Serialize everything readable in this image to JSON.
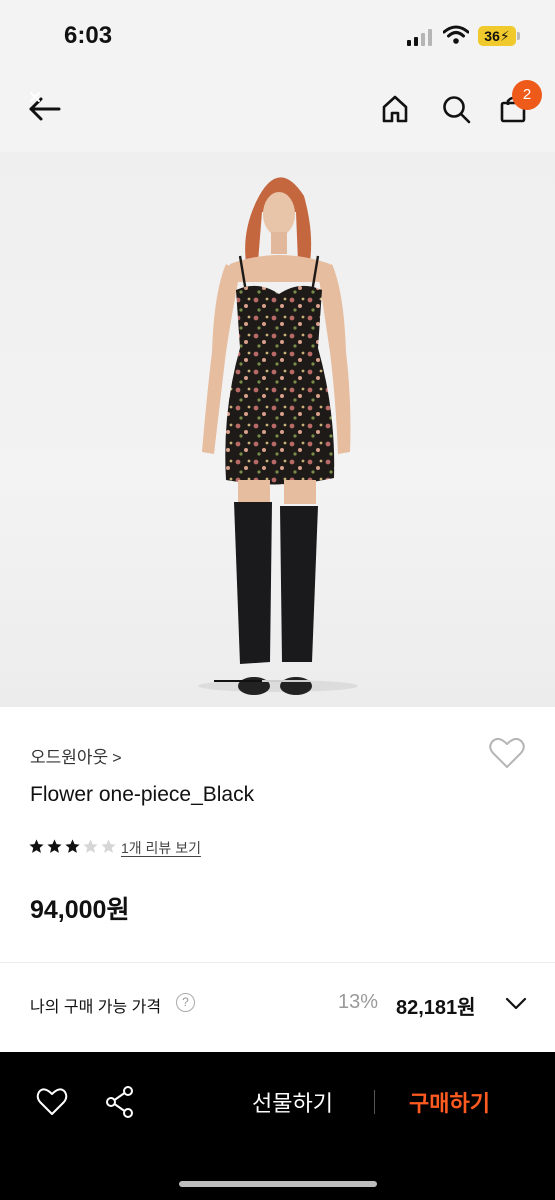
{
  "status_bar": {
    "time": "6:03",
    "battery": "36"
  },
  "nav": {
    "cart_count": "2"
  },
  "product": {
    "brand": "오드원아웃",
    "brand_chevron": ">",
    "title": "Flower one-piece_Black",
    "rating": 3,
    "rating_max": 5,
    "review_link": "1개 리뷰 보기",
    "price": "94,000원"
  },
  "purchase_price": {
    "label": "나의 구매 가능 가격",
    "help": "?",
    "discount": "13%",
    "price": "82,181원"
  },
  "bottom_bar": {
    "gift_label": "선물하기",
    "buy_label": "구매하기"
  },
  "colors": {
    "accent": "#ee5a1a",
    "buy": "#ff5a1f",
    "bar_bg": "#000000"
  },
  "icons": [
    "back-arrow-icon",
    "home-icon",
    "search-icon",
    "bag-icon",
    "heart-icon",
    "share-icon",
    "chevron-down-icon",
    "star-icon",
    "help-icon"
  ],
  "carousel": {
    "progress": 0.5
  }
}
